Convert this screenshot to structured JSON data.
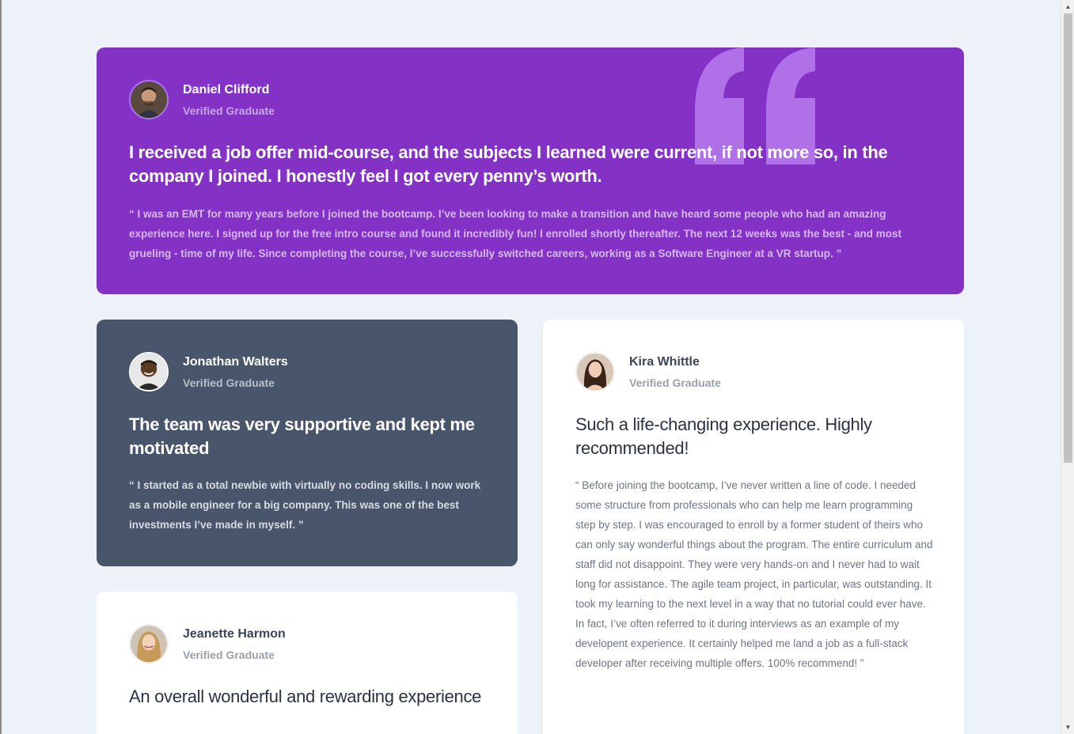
{
  "testimonials": [
    {
      "name": "Daniel Clifford",
      "role": "Verified Graduate",
      "headline": "I received a job offer mid-course, and the subjects I learned were current, if not more so, in the company I joined. I honestly feel I got every penny’s worth.",
      "body": "“ I was an EMT for many years before I joined the bootcamp. I’ve been looking to make a transition and have heard some people who had an amazing experience here. I signed up for the free intro course and found it incredibly fun! I enrolled shortly thereafter. The next 12 weeks was the best - and most grueling - time of my life. Since completing the course, I’ve successfully switched careers, working as a Software Engineer at a VR startup. ”",
      "color": "#8431c6"
    },
    {
      "name": "Jonathan Walters",
      "role": "Verified Graduate",
      "headline": "The team was very supportive and kept me motivated",
      "body": "“ I started as a total newbie with virtually no coding skills. I now work as a mobile engineer for a big company. This was one of the best investments I’ve made in myself. ”",
      "color": "#48556a"
    },
    {
      "name": "Kira Whittle",
      "role": "Verified Graduate",
      "headline": "Such a life-changing experience. Highly recommended!",
      "body": "“ Before joining the bootcamp, I’ve never written a line of code. I needed some structure from professionals who can help me learn programming step by step. I was encouraged to enroll by a former student of theirs who can only say wonderful things about the program. The entire curriculum and staff did not disappoint. They were very hands-on and I never had to wait long for assistance. The agile team project, in particular, was outstanding. It took my learning to the next level in a way that no tutorial could ever have. In fact, I’ve often referred to it during interviews as an example of my developent experience. It certainly helped me land a job as a full-stack developer after receiving multiple offers. 100% recommend! ”",
      "color": "#ffffff"
    },
    {
      "name": "Jeanette Harmon",
      "role": "Verified Graduate",
      "headline": "An overall wonderful and rewarding experience",
      "color": "#ffffff"
    }
  ],
  "icons": {
    "quote": "quotation-mark-icon",
    "scroll_up": "scroll-up-arrow-icon",
    "scroll_down": "scroll-down-arrow-icon"
  },
  "colors": {
    "background": "#ecf2f8",
    "purple": "#8431c6",
    "slate": "#48556a",
    "white": "#ffffff"
  }
}
